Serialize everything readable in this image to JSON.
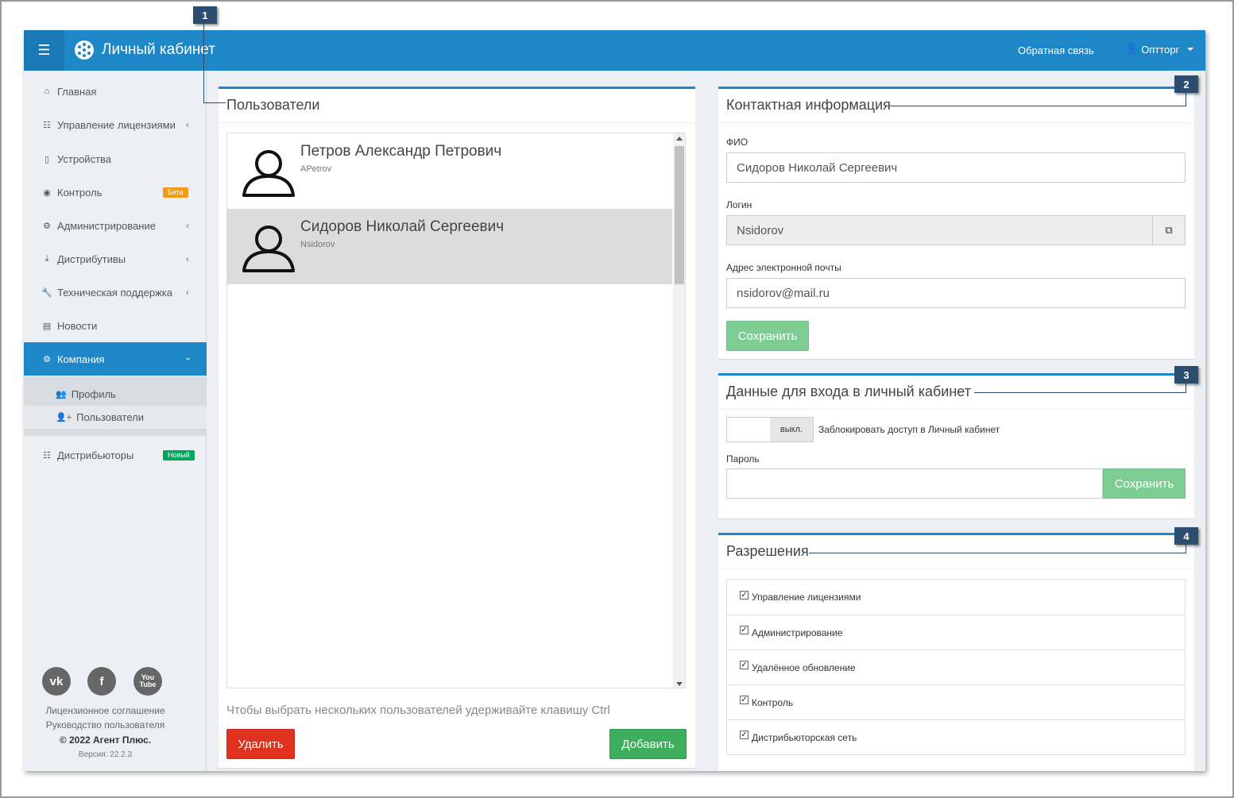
{
  "header": {
    "menu_icon": "hamburger-icon",
    "app_title": "Личный кабинет",
    "feedback": "Обратная связь",
    "user": "Оптторг"
  },
  "sidebar": {
    "items": [
      {
        "label": "Главная",
        "icon": "home-icon"
      },
      {
        "label": "Управление лицензиями",
        "icon": "sitemap-icon"
      },
      {
        "label": "Устройства",
        "icon": "mobile-icon"
      },
      {
        "label": "Контроль",
        "icon": "globe-icon",
        "badge": "Бета"
      },
      {
        "label": "Администрирование",
        "icon": "gears-icon"
      },
      {
        "label": "Дистрибутивы",
        "icon": "download-icon"
      },
      {
        "label": "Техническая поддержка",
        "icon": "wrench-icon"
      },
      {
        "label": "Новости",
        "icon": "newspaper-icon"
      },
      {
        "label": "Компания",
        "icon": "gear-icon"
      },
      {
        "label": "Дистрибьюторы",
        "icon": "sitemap-icon",
        "badge": "Новый"
      }
    ],
    "subitems": [
      {
        "label": "Профиль",
        "icon": "users-icon"
      },
      {
        "label": "Пользователи",
        "icon": "user-plus-icon"
      }
    ],
    "footer": {
      "license": "Лицензионное соглашение",
      "manual": "Руководство пользователя",
      "copyright": "© 2022 Агент Плюс.",
      "version": "Версия: 22.2.3"
    },
    "social": [
      "vk-icon",
      "facebook-icon",
      "youtube-icon"
    ]
  },
  "users_panel": {
    "title": "Пользователи",
    "users": [
      {
        "name": "Петров Александр Петрович",
        "login": "APetrov"
      },
      {
        "name": "Сидоров Николай Сергеевич",
        "login": "Nsidorov"
      }
    ],
    "hint": "Чтобы выбрать нескольких пользователей удерживайте клавишу Ctrl",
    "delete_label": "Удалить",
    "add_label": "Добавить"
  },
  "contact_panel": {
    "title": "Контактная информация",
    "fio_label": "ФИО",
    "fio_value": "Сидоров Николай Сергеевич",
    "login_label": "Логин",
    "login_value": "Nsidorov",
    "email_label": "Адрес электронной почты",
    "email_value": "nsidorov@mail.ru",
    "save_label": "Сохранить"
  },
  "login_panel": {
    "title": "Данные для входа в личный кабинет",
    "toggle_state": "выкл.",
    "block_label": "Заблокировать доступ в Личный кабинет",
    "password_label": "Пароль",
    "password_value": "",
    "save_label": "Сохранить"
  },
  "permissions_panel": {
    "title": "Разрешения",
    "items": [
      {
        "label": "Управление лицензиями",
        "checked": true
      },
      {
        "label": "Администрирование",
        "checked": true
      },
      {
        "label": "Удалённое обновление",
        "checked": true
      },
      {
        "label": "Контроль",
        "checked": true
      },
      {
        "label": "Дистрибьюторская сеть",
        "checked": true
      }
    ]
  },
  "callouts": [
    "1",
    "2",
    "3",
    "4"
  ],
  "colors": {
    "primary": "#1e87c7",
    "danger": "#e0301e",
    "success": "#3cae5c",
    "success_light": "#7ccc94",
    "badge_beta": "#f39c12",
    "badge_new": "#00a65a",
    "callout": "#2c4d6e"
  }
}
